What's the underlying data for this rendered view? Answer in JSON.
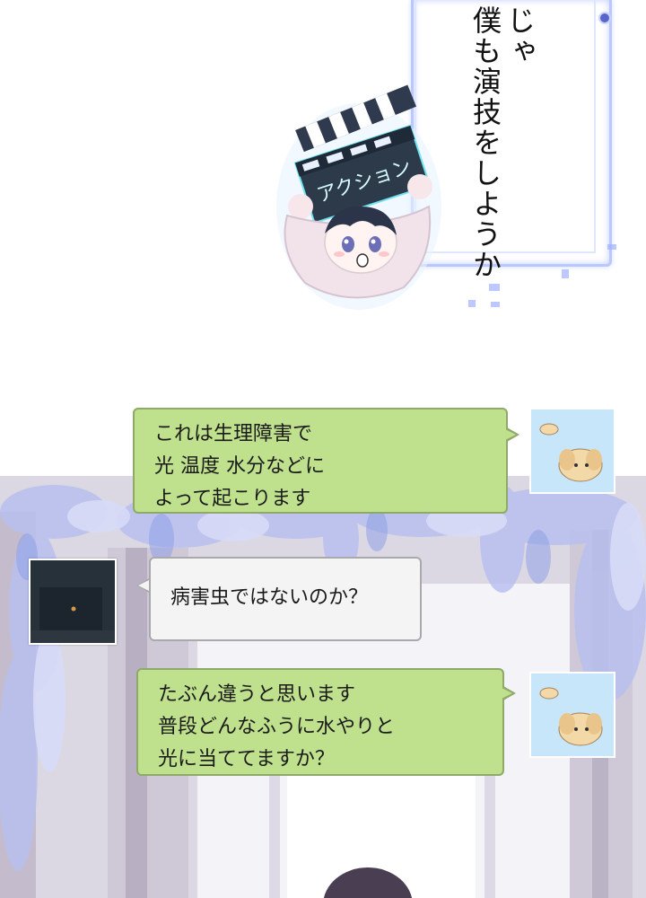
{
  "panel_top": {
    "vertical_caption": "じゃ\n僕も演技をしようか",
    "clapperboard_text": "アクション"
  },
  "chat": {
    "messages": [
      {
        "side": "right",
        "style": "green",
        "lines": [
          "これは生理障害で",
          "光 温度 水分などに",
          "よって起こります"
        ],
        "avatar": "puppy-avatar"
      },
      {
        "side": "left",
        "style": "white",
        "lines": [
          "病害虫ではないのか？"
        ],
        "avatar": "dark-avatar"
      },
      {
        "side": "right",
        "style": "green",
        "lines": [
          "たぶん違うと思います",
          "普段どんなふうに水やりと",
          "光に当ててますか？"
        ],
        "avatar": "puppy-avatar"
      }
    ]
  },
  "colors": {
    "bubble_green": "#bfe08c",
    "bubble_white": "#f4f4f5",
    "frame_blue": "#b9c9ff",
    "avatar_sky": "#c8e6f9"
  }
}
